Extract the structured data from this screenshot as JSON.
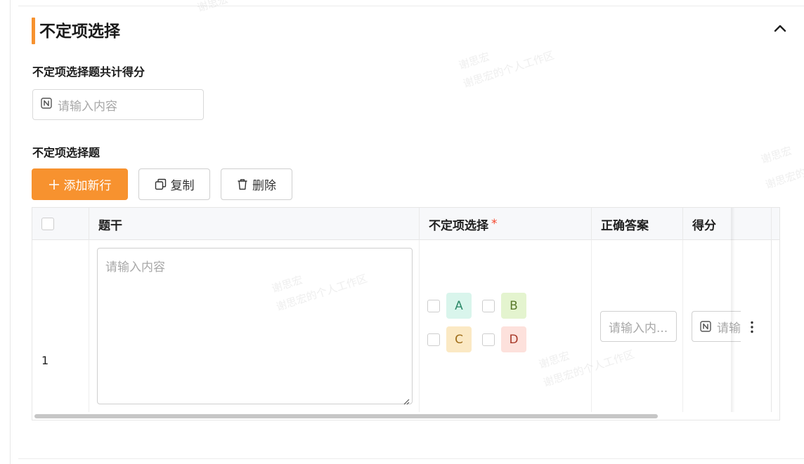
{
  "section": {
    "title": "不定项选择"
  },
  "total_score": {
    "label": "不定项选择题共计得分",
    "placeholder": "请输入内容"
  },
  "questions": {
    "label": "不定项选择题",
    "buttons": {
      "add": "添加新行",
      "copy": "复制",
      "delete": "删除"
    },
    "table": {
      "columns": {
        "stem": "题干",
        "options": "不定项选择",
        "options_required_mark": "*",
        "answer": "正确答案",
        "score": "得分"
      },
      "rows": [
        {
          "index": "1",
          "stem_placeholder": "请输入内容",
          "options": [
            {
              "label": "A",
              "bg": "#d9f5ec",
              "fg": "#2e8a6a"
            },
            {
              "label": "B",
              "bg": "#e4f4cf",
              "fg": "#5a7a2a"
            },
            {
              "label": "C",
              "bg": "#fbe9c4",
              "fg": "#a06e1a"
            },
            {
              "label": "D",
              "bg": "#fde1dc",
              "fg": "#a83a2a"
            }
          ],
          "answer_placeholder": "请输入内...",
          "score_placeholder": "请输"
        }
      ]
    }
  },
  "watermark": {
    "line1": "谢思宏",
    "line2": "谢思宏的个人工作区"
  },
  "colors": {
    "accent": "#f7922f",
    "required": "#f5462d"
  }
}
